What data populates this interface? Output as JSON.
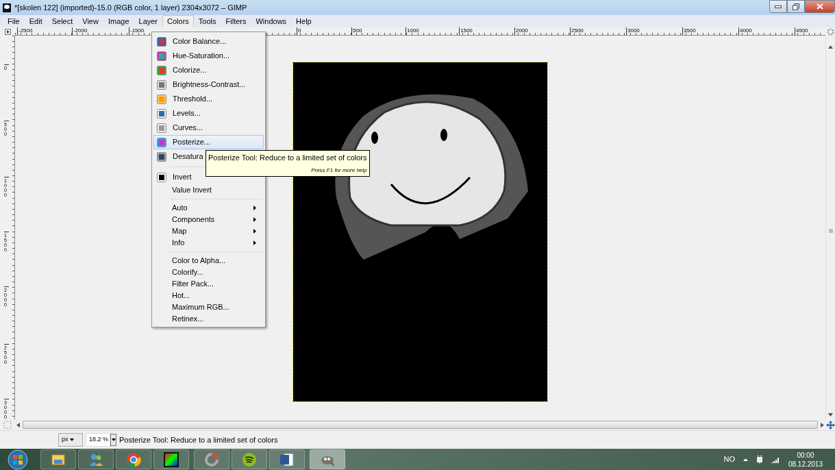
{
  "window": {
    "title": "*[skolen 122] (imported)-15.0 (RGB color, 1 layer) 2304x3072 – GIMP"
  },
  "menubar": [
    {
      "label": "File",
      "selected": false
    },
    {
      "label": "Edit",
      "selected": false
    },
    {
      "label": "Select",
      "selected": false
    },
    {
      "label": "View",
      "selected": false
    },
    {
      "label": "Image",
      "selected": false
    },
    {
      "label": "Layer",
      "selected": false
    },
    {
      "label": "Colors",
      "selected": true
    },
    {
      "label": "Tools",
      "selected": false
    },
    {
      "label": "Filters",
      "selected": false
    },
    {
      "label": "Windows",
      "selected": false
    },
    {
      "label": "Help",
      "selected": false
    }
  ],
  "rulers": {
    "horizontal": [
      "-2500",
      "-2000",
      "-1500",
      "0",
      "500",
      "1000",
      "1500",
      "2000",
      "2500",
      "3000",
      "3500",
      "4000",
      "4500"
    ],
    "vertical": [
      "0",
      "500",
      "1000",
      "1500",
      "2000",
      "2500",
      "3000"
    ]
  },
  "colors_menu": [
    {
      "kind": "icon_item",
      "label": "Color Balance...",
      "selected": false
    },
    {
      "kind": "icon_item",
      "label": "Hue-Saturation...",
      "selected": false
    },
    {
      "kind": "icon_item",
      "label": "Colorize...",
      "selected": false
    },
    {
      "kind": "icon_item",
      "label": "Brightness-Contrast...",
      "selected": false
    },
    {
      "kind": "icon_item",
      "label": "Threshold...",
      "selected": false
    },
    {
      "kind": "icon_item",
      "label": "Levels...",
      "selected": false
    },
    {
      "kind": "icon_item",
      "label": "Curves...",
      "selected": false
    },
    {
      "kind": "icon_item",
      "label": "Posterize...",
      "selected": true
    },
    {
      "kind": "icon_item",
      "label": "Desatura",
      "selected": false
    },
    {
      "kind": "separator"
    },
    {
      "kind": "icon_item",
      "label": "Invert",
      "selected": false
    },
    {
      "kind": "item",
      "label": "Value Invert",
      "selected": false
    },
    {
      "kind": "separator"
    },
    {
      "kind": "submenu",
      "label": "Auto",
      "selected": false
    },
    {
      "kind": "submenu",
      "label": "Components",
      "selected": false
    },
    {
      "kind": "submenu",
      "label": "Map",
      "selected": false
    },
    {
      "kind": "submenu",
      "label": "Info",
      "selected": false
    },
    {
      "kind": "separator"
    },
    {
      "kind": "item",
      "label": "Color to Alpha...",
      "selected": false
    },
    {
      "kind": "item",
      "label": "Colorify...",
      "selected": false
    },
    {
      "kind": "item",
      "label": "Filter Pack...",
      "selected": false
    },
    {
      "kind": "item",
      "label": "Hot...",
      "selected": false
    },
    {
      "kind": "item",
      "label": "Maximum RGB...",
      "selected": false
    },
    {
      "kind": "item",
      "label": "Retinex...",
      "selected": false
    }
  ],
  "tooltip": {
    "text": "Posterize Tool: Reduce to a limited set of colors",
    "help": "Press F1 for more help"
  },
  "status_bar": {
    "unit": "px",
    "zoom": "18.2 %",
    "message": "Posterize Tool: Reduce to a limited set of colors"
  },
  "taskbar": {
    "apps": [
      {
        "selected": false
      },
      {
        "selected": false
      },
      {
        "selected": false
      },
      {
        "selected": false
      },
      {
        "selected": false
      },
      {
        "selected": false
      },
      {
        "selected": false
      },
      {
        "selected": true
      }
    ],
    "language": "NO",
    "time": "00:00",
    "date": "08.12.2013"
  }
}
